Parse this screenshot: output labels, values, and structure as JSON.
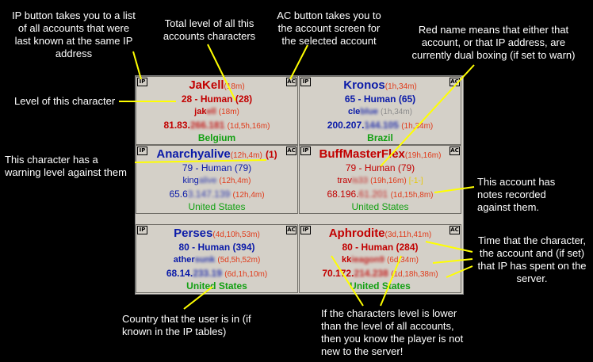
{
  "annotations": {
    "ip_button": "IP button takes you to a list of all accounts that were last known at the same IP address",
    "total_level": "Total level of all this accounts characters",
    "ac_button": "AC button takes you to the account screen for the selected account",
    "red_name": "Red name means that either that account, or that IP address, are currently dual boxing (if set to warn)",
    "level_char": "Level of this character",
    "warning": "This character has a warning level against them",
    "notes": "This account has notes recorded against them.",
    "time": "Time that the character, the account and (if set) that IP has spent on the server.",
    "country": "Country that the user is in (if known in the IP tables)",
    "level_lower": "If the characters level is lower than the level of all accounts, then you know the player is not new to the server!"
  },
  "cells": [
    {
      "ip_label": "IP",
      "ac_label": "AC",
      "name": "JaKell",
      "name_time": "(18m)",
      "level": "28 - Human (28)",
      "account": "jak",
      "account_blur": "ell",
      "account_time": "(18m)",
      "ip": "81.83.",
      "ip_blur": "266.181",
      "ip_time": "(1d,5h,16m)",
      "country": "Belgium"
    },
    {
      "ip_label": "IP",
      "ac_label": "AC",
      "name": "Kronos",
      "name_time": "(1h,34m)",
      "level": "65 - Human (65)",
      "account": "cle",
      "account_blur": "blue",
      "account_time": "(1h,34m)",
      "ip": "200.207.",
      "ip_blur": "144.105",
      "ip_time": "(1h,34m)",
      "country": "Brazil"
    },
    {
      "ip_label": "IP",
      "ac_label": "AC",
      "name": "Anarchyalive",
      "name_time": "(12h,4m)",
      "warning": "(1)",
      "level": "79 - Human (79)",
      "account": "king",
      "account_blur": "alive",
      "account_time": "(12h,4m)",
      "ip": "65.6",
      "ip_blur": "3.147.139",
      "ip_time": "(12h,4m)",
      "country": "United States"
    },
    {
      "ip_label": "IP",
      "ac_label": "AC",
      "name": "BuffMasterFlex",
      "name_time": "(19h,16m)",
      "level": "79 - Human (79)",
      "account": "trav",
      "account_blur": "is33",
      "account_time": "(19h,16m)",
      "notes": "[-1-]",
      "ip": "68.196.",
      "ip_blur": "61.201",
      "ip_time": "(1d,15h,8m)",
      "country": "United States"
    },
    {
      "ip_label": "IP",
      "ac_label": "AC",
      "name": "Perses",
      "name_time": "(4d,10h,53m)",
      "level": "80 - Human (394)",
      "account": "ather",
      "account_blur": "sunk",
      "account_time": "(5d,5h,52m)",
      "ip": "68.14.",
      "ip_blur": "233.19",
      "ip_time": "(6d,1h,10m)",
      "country": "United States"
    },
    {
      "ip_label": "IP",
      "ac_label": "AC",
      "name": "Aphrodite",
      "name_time": "(3d,11h,41m)",
      "level": "80 - Human (284)",
      "account": "kk",
      "account_blur": "ieagon9",
      "account_time": "(6d,34m)",
      "ip": "70.172.",
      "ip_blur": "214.238",
      "ip_time": "(1d,18h,38m)",
      "country": "United States"
    }
  ],
  "colors": {
    "annotation_text": "#ffffff",
    "arrow": "#ffff00",
    "panel_bg": "#d4d0c8",
    "name_blue": "#0a1aa8",
    "name_red": "#c20000",
    "time_red": "#e03a1a",
    "country_green": "#12a012",
    "notes_yellow": "#e8c800"
  }
}
